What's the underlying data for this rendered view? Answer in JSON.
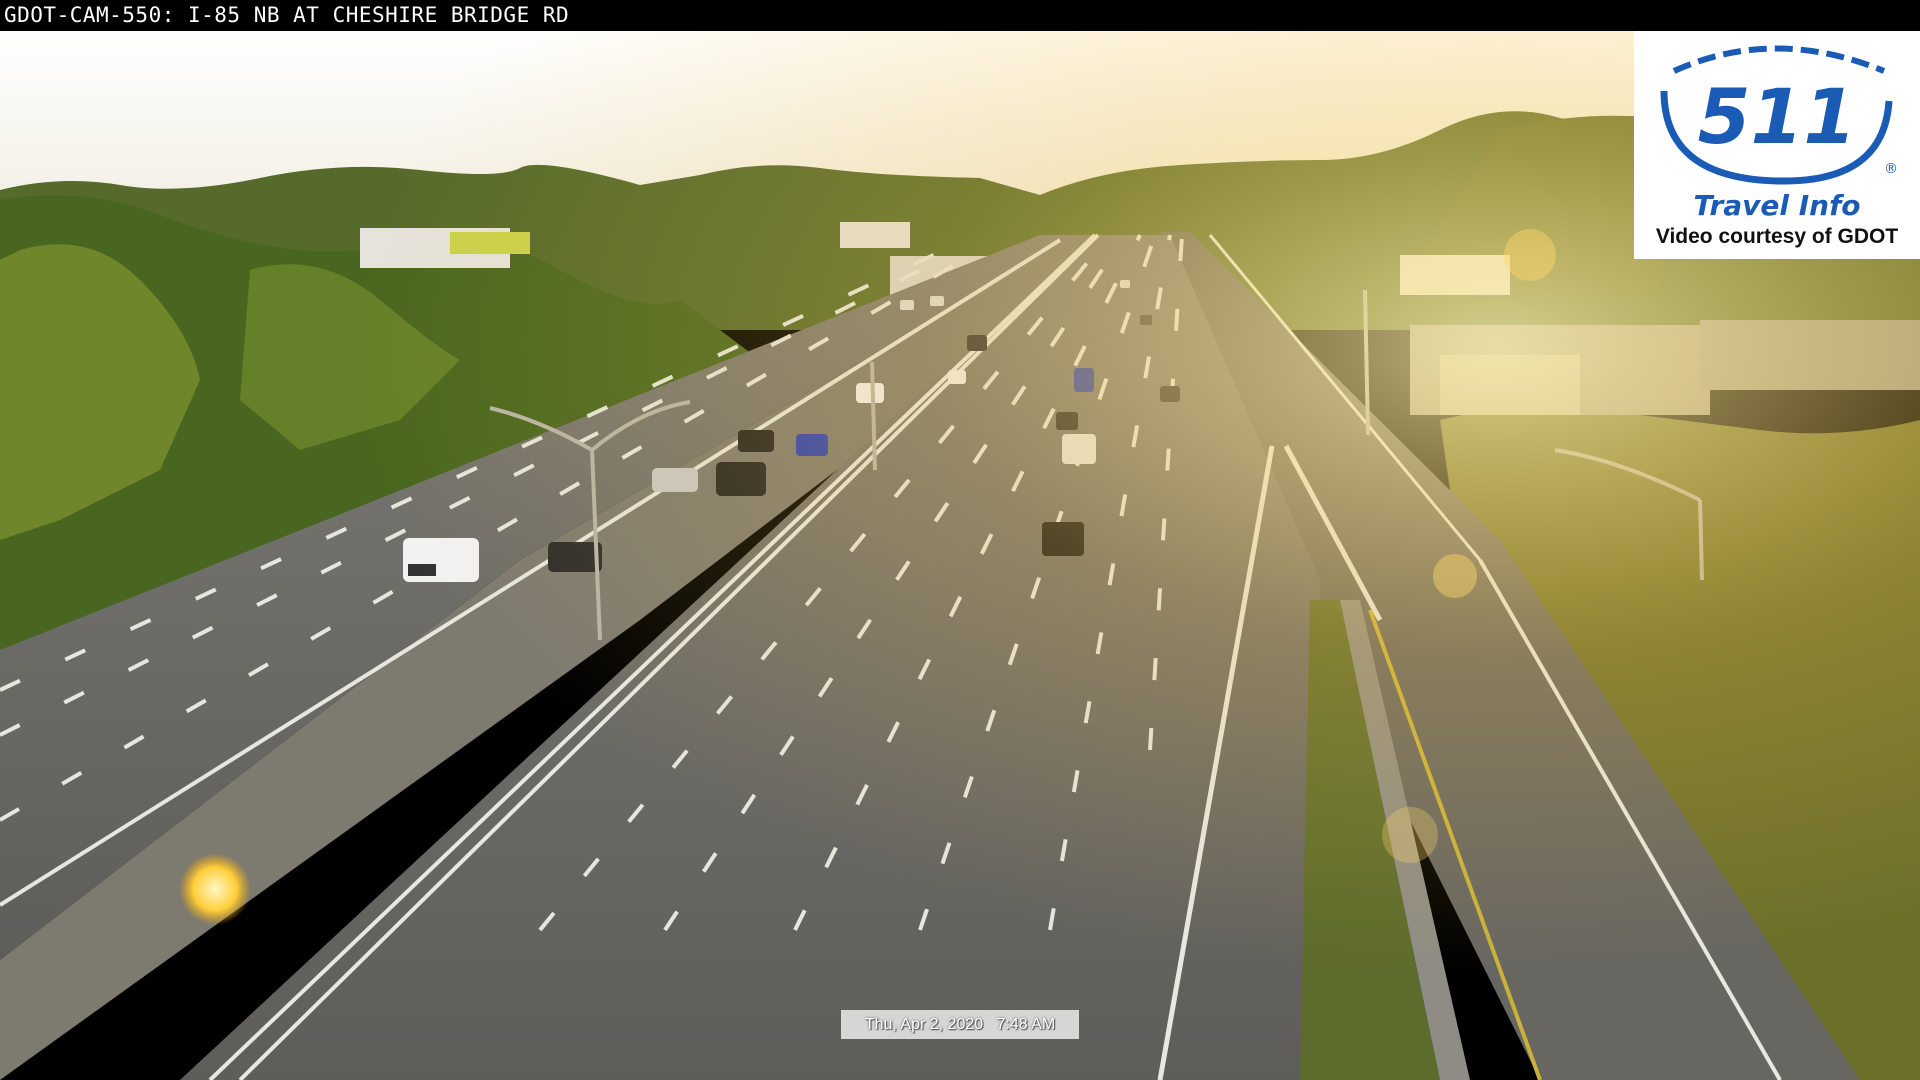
{
  "camera": {
    "title": "GDOT-CAM-550: I-85 NB AT CHESHIRE BRIDGE RD",
    "timestamp": "Thu, Apr 2, 2020   7:48 AM"
  },
  "logo": {
    "number": "511",
    "trademark": "®",
    "tagline": "Travel Info",
    "courtesy": "Video courtesy of GDOT"
  },
  "colors": {
    "sky": "#f7f5ee",
    "trees": "#4f6b22",
    "pavement": "#6b6a66",
    "sun_glare": "#ffd75a",
    "logo_blue": "#1a5bb5"
  }
}
